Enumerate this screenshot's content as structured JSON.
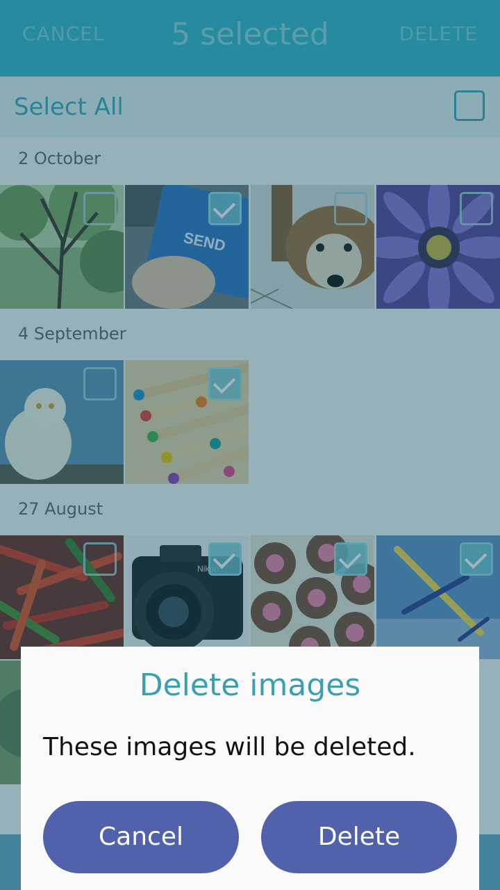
{
  "header": {
    "cancel": "CANCEL",
    "title": "5 selected",
    "delete": "DELETE"
  },
  "select_all": {
    "label": "Select All",
    "checked": false
  },
  "sections": [
    {
      "date": "2 October",
      "tiles": [
        {
          "name": "tree-photo",
          "checked": false
        },
        {
          "name": "send-key-photo",
          "checked": true
        },
        {
          "name": "dog-photo",
          "checked": false
        },
        {
          "name": "purple-flower-photo",
          "checked": false
        }
      ]
    },
    {
      "date": "4 September",
      "tiles": [
        {
          "name": "owl-photo",
          "checked": false
        },
        {
          "name": "colored-pencils-photo",
          "checked": true
        }
      ]
    },
    {
      "date": "27 August",
      "tiles": [
        {
          "name": "chili-peppers-photo",
          "checked": false
        },
        {
          "name": "camera-photo",
          "checked": true
        },
        {
          "name": "heart-cookies-photo",
          "checked": true
        },
        {
          "name": "airplane-photo",
          "checked": true
        }
      ]
    }
  ],
  "camera_brand": "Nikon",
  "key_label": "SEND",
  "dialog": {
    "title": "Delete images",
    "message": "These images will be deleted.",
    "cancel": "Cancel",
    "delete": "Delete"
  },
  "colors": {
    "accent": "#35b6c8",
    "button": "#5161ab"
  }
}
